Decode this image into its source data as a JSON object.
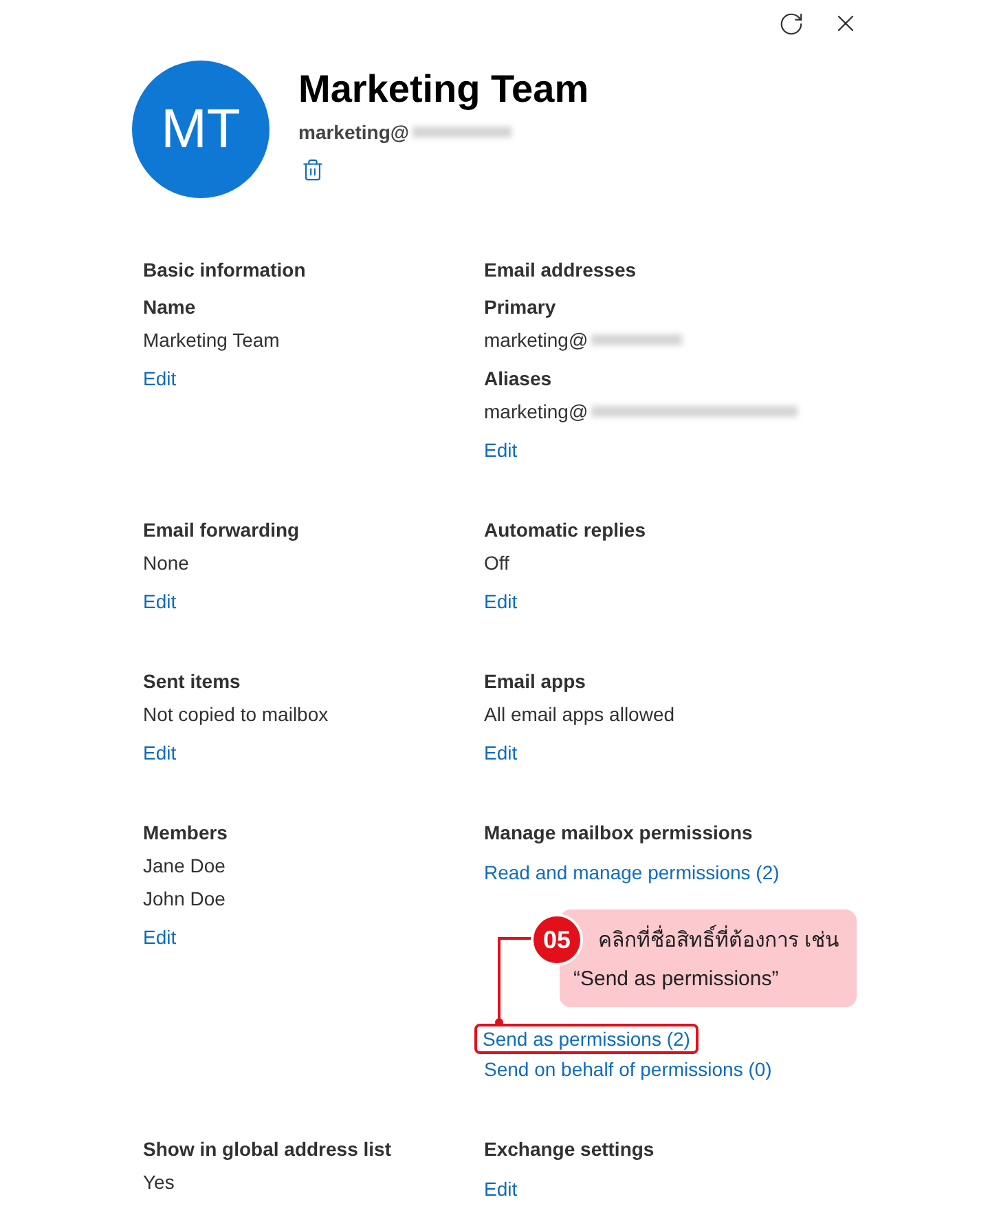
{
  "header": {
    "initials": "MT",
    "name": "Marketing Team",
    "email": "marketing@"
  },
  "rows": [
    {
      "cells": [
        {
          "title": "Basic information",
          "items": [
            {
              "kind": "label",
              "text": "Name"
            },
            {
              "kind": "value",
              "text": "Marketing Team"
            },
            {
              "kind": "link",
              "text": "Edit"
            }
          ]
        },
        {
          "title": "Email addresses",
          "items": [
            {
              "kind": "label",
              "text": "Primary"
            },
            {
              "kind": "value",
              "text": "marketing@",
              "redacted": true
            },
            {
              "kind": "label",
              "text": "Aliases"
            },
            {
              "kind": "value",
              "text": "marketing@",
              "redacted": true
            },
            {
              "kind": "link",
              "text": "Edit"
            }
          ]
        }
      ]
    },
    {
      "cells": [
        {
          "title": "Email forwarding",
          "items": [
            {
              "kind": "value",
              "text": "None"
            },
            {
              "kind": "link",
              "text": "Edit"
            }
          ]
        },
        {
          "title": "Automatic replies",
          "items": [
            {
              "kind": "value",
              "text": "Off"
            },
            {
              "kind": "link",
              "text": "Edit"
            }
          ]
        }
      ]
    },
    {
      "cells": [
        {
          "title": "Sent items",
          "items": [
            {
              "kind": "value",
              "text": "Not copied to mailbox"
            },
            {
              "kind": "link",
              "text": "Edit"
            }
          ]
        },
        {
          "title": "Email apps",
          "items": [
            {
              "kind": "value",
              "text": "All email apps allowed"
            },
            {
              "kind": "link",
              "text": "Edit"
            }
          ]
        }
      ]
    },
    {
      "cells": [
        {
          "title": "Members",
          "items": [
            {
              "kind": "value",
              "text": "Jane Doe"
            },
            {
              "kind": "value",
              "text": "John Doe"
            },
            {
              "kind": "link",
              "text": "Edit"
            }
          ]
        },
        {
          "title": "Manage mailbox permissions",
          "items": [
            {
              "kind": "link",
              "text": "Read and manage permissions (2)"
            },
            {
              "kind": "callout",
              "number": "05",
              "lines": [
                "คลิกที่ชื่อสิทธิ์ที่ต้องการ เช่น",
                "“Send as permissions”"
              ]
            },
            {
              "kind": "link",
              "text": "Send as permissions (2)",
              "highlighted": true
            },
            {
              "kind": "link",
              "text": "Send on behalf of permissions (0)"
            }
          ]
        }
      ]
    },
    {
      "cells": [
        {
          "title": "Show in global address list",
          "items": [
            {
              "kind": "value",
              "text": "Yes"
            }
          ]
        },
        {
          "title": "Exchange settings",
          "items": [
            {
              "kind": "link",
              "text": "Edit"
            }
          ]
        }
      ]
    }
  ]
}
